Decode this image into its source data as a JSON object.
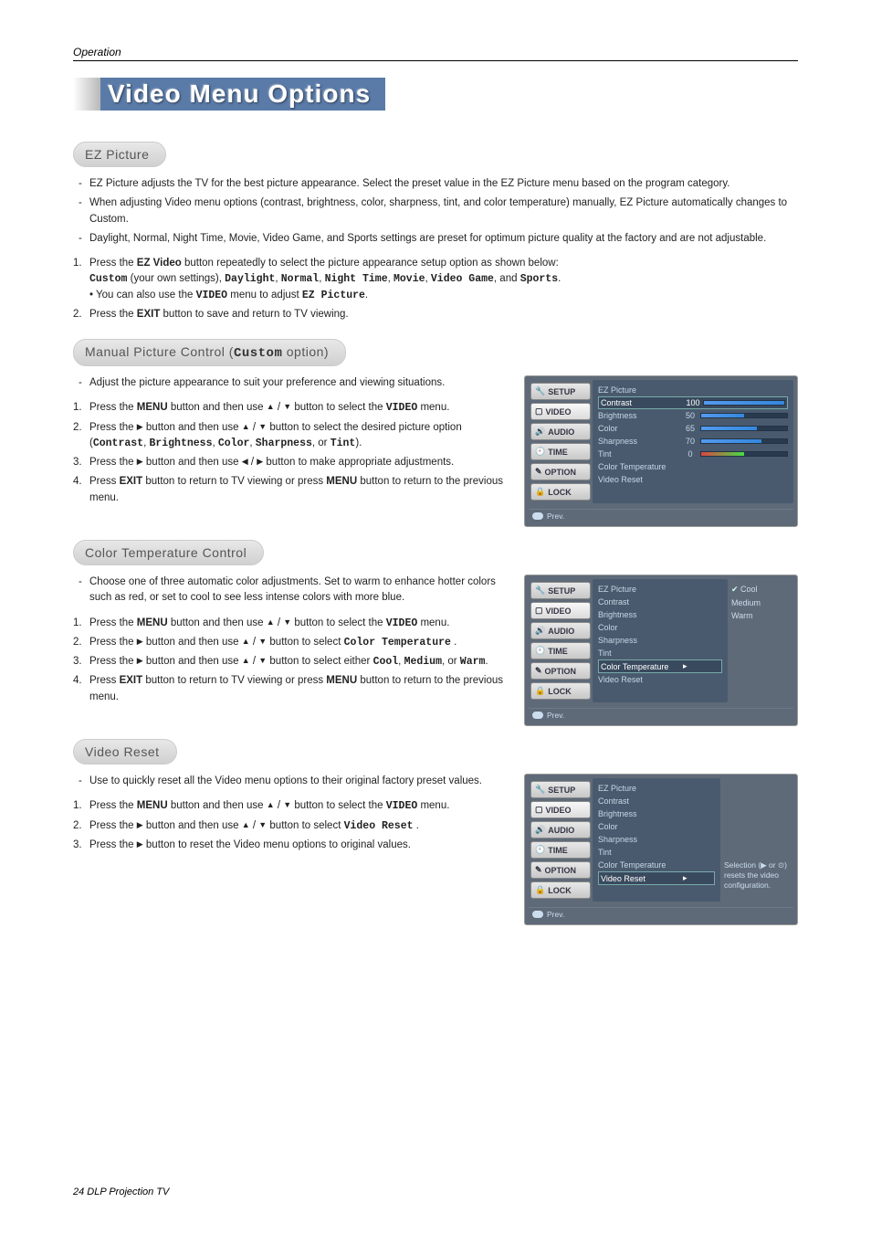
{
  "header": {
    "section": "Operation"
  },
  "title": "Video Menu Options",
  "ezPicture": {
    "heading": "EZ Picture",
    "notes": [
      "EZ Picture adjusts the TV for the best picture appearance. Select the preset value in the EZ Picture menu based on the program category.",
      "When adjusting Video menu options (contrast, brightness, color, sharpness, tint, and color temperature) manually, EZ Picture automatically changes to Custom.",
      "Daylight, Normal, Night Time, Movie, Video Game, and Sports settings are preset for optimum picture quality at the factory and are not adjustable."
    ],
    "steps_html": [
      "Press the <b>EZ Video</b> button repeatedly to select the picture appearance setup option as shown below:<br><span class='mono'>Custom</span> (your own settings), <span class='mono'>Daylight</span>, <span class='mono'>Normal</span>, <span class='mono'>Night Time</span>, <span class='mono'>Movie</span>, <span class='mono'>Video Game</span>, and <span class='mono'>Sports</span>.<br>• You can also use the <span class='mono'>VIDEO</span> menu to adjust <span class='mono'>EZ Picture</span>.",
      "Press the <b>EXIT</b> button to save and return to TV viewing."
    ]
  },
  "manual": {
    "heading_pre": "Manual Picture Control (",
    "heading_emph": "Custom",
    "heading_post": " option)",
    "notes": [
      "Adjust the picture appearance to suit your preference and viewing situations."
    ],
    "steps_html": [
      "Press the <b>MENU</b> button and then use <span class='tri'>▲</span> / <span class='tri'>▼</span> button to select the <span class='mono'>VIDEO</span> menu.",
      "Press the <span class='tri'>▶</span> button and then use <span class='tri'>▲</span> / <span class='tri'>▼</span> button to select the desired picture option (<span class='mono'>Contrast</span>, <span class='mono'>Brightness</span>, <span class='mono'>Color</span>, <span class='mono'>Sharpness</span>, or <span class='mono'>Tint</span>).",
      "Press the <span class='tri'>▶</span> button and then use <span class='tri'>◀</span> / <span class='tri'>▶</span> button to make appropriate adjustments.",
      "Press <b>EXIT</b> button to return to TV viewing or press <b>MENU</b> button to return to the previous menu."
    ]
  },
  "colorTemp": {
    "heading": "Color Temperature Control",
    "notes": [
      "Choose one of three automatic color adjustments. Set to warm to enhance hotter colors such as red, or set to cool to see less intense colors with more blue."
    ],
    "steps_html": [
      "Press the <b>MENU</b> button and then use <span class='tri'>▲</span> / <span class='tri'>▼</span> button to select the <span class='mono'>VIDEO</span> menu.",
      "Press the <span class='tri'>▶</span> button and then use <span class='tri'>▲</span> / <span class='tri'>▼</span> button to select <span class='mono'>Color Temperature</span> .",
      "Press the <span class='tri'>▶</span> button and then use <span class='tri'>▲</span> / <span class='tri'>▼</span> button to select either <span class='mono'>Cool</span>, <span class='mono'>Medium</span>, or <span class='mono'>Warm</span>.",
      "Press <b>EXIT</b> button to return to TV viewing or press <b>MENU</b> button to return to the previous menu."
    ]
  },
  "videoReset": {
    "heading": "Video Reset",
    "notes": [
      "Use to quickly reset all the Video menu options to their original factory preset values."
    ],
    "steps_html": [
      "Press the <b>MENU</b> button and then use <span class='tri'>▲</span> / <span class='tri'>▼</span> button to select the <span class='mono'>VIDEO</span> menu.",
      "Press the <span class='tri'>▶</span> button and then use <span class='tri'>▲</span> / <span class='tri'>▼</span> button to select <span class='mono'>Video Reset</span> .",
      "Press the <span class='tri'>▶</span> button to reset the Video menu options to original values."
    ]
  },
  "osd": {
    "tabs": [
      "SETUP",
      "VIDEO",
      "AUDIO",
      "TIME",
      "OPTION",
      "LOCK"
    ],
    "footer_label": "Prev.",
    "panel1": {
      "title": "EZ Picture",
      "rows": [
        {
          "label": "Contrast",
          "value": 100,
          "highlight": true
        },
        {
          "label": "Brightness",
          "value": 50
        },
        {
          "label": "Color",
          "value": 65
        },
        {
          "label": "Sharpness",
          "value": 70
        },
        {
          "label": "Tint",
          "value": 0,
          "tint": true
        }
      ],
      "extra": [
        "Color Temperature",
        "Video Reset"
      ]
    },
    "panel2": {
      "title": "EZ Picture",
      "items": [
        "Contrast",
        "Brightness",
        "Color",
        "Sharpness",
        "Tint"
      ],
      "highlight": {
        "label": "Color Temperature",
        "arrow": true
      },
      "after": [
        "Video Reset"
      ],
      "options": [
        {
          "label": "Cool",
          "checked": true
        },
        {
          "label": "Medium"
        },
        {
          "label": "Warm"
        }
      ]
    },
    "panel3": {
      "title": "EZ Picture",
      "items": [
        "Contrast",
        "Brightness",
        "Color",
        "Sharpness",
        "Tint",
        "Color Temperature"
      ],
      "highlight": {
        "label": "Video Reset",
        "arrow": true
      },
      "hint": "Selection (▶ or ⊙) resets the video configuration."
    }
  },
  "footer": "24  DLP Projection TV",
  "chart_data": {
    "type": "table",
    "title": "Video menu slider values (Manual Picture Control OSD)",
    "categories": [
      "Contrast",
      "Brightness",
      "Color",
      "Sharpness",
      "Tint"
    ],
    "values": [
      100,
      50,
      65,
      70,
      0
    ],
    "range": [
      0,
      100
    ]
  }
}
